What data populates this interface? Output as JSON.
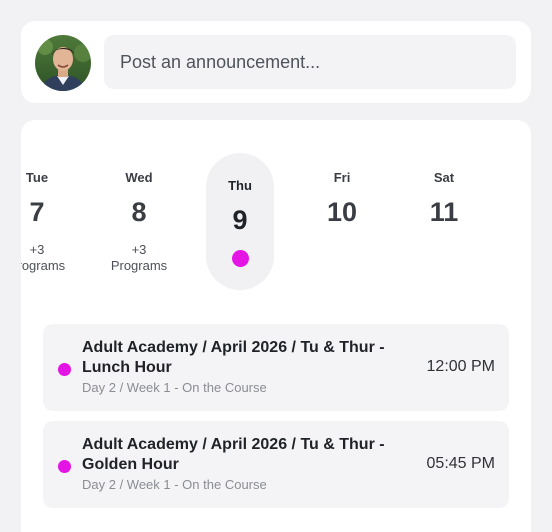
{
  "composer": {
    "placeholder": "Post an announcement..."
  },
  "calendar": {
    "days": [
      {
        "name": "Tue",
        "num": "7",
        "programs": [
          "+3",
          "Programs"
        ]
      },
      {
        "name": "Wed",
        "num": "8",
        "programs": [
          "+3",
          "Programs"
        ]
      },
      {
        "name": "Thu",
        "num": "9",
        "selected": true,
        "has_event_dot": true
      },
      {
        "name": "Fri",
        "num": "10"
      },
      {
        "name": "Sat",
        "num": "11"
      }
    ]
  },
  "events": [
    {
      "title": "Adult Academy / April 2026 / Tu & Thur - Lunch Hour",
      "subtitle": "Day 2 / Week 1 - On the Course",
      "time": "12:00 PM",
      "color": "#e414e4"
    },
    {
      "title": "Adult Academy / April 2026 / Tu & Thur - Golden Hour",
      "subtitle": "Day 2 / Week 1 - On the Course",
      "time": "05:45 PM",
      "color": "#e414e4"
    }
  ],
  "colors": {
    "accent": "#e414e4",
    "background": "#f2f2f5",
    "card": "#ffffff"
  }
}
